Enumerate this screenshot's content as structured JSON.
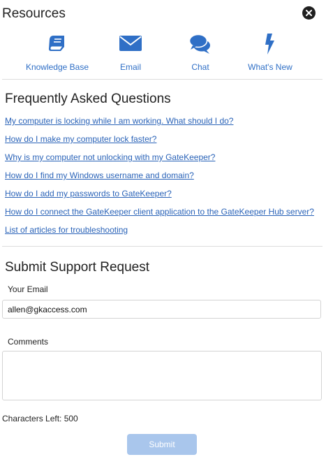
{
  "header": {
    "title": "Resources",
    "close_icon": "close-circle-icon"
  },
  "accent_color": "#2f6fc6",
  "quick_links": [
    {
      "label": "Knowledge Base",
      "icon": "book-icon"
    },
    {
      "label": "Email",
      "icon": "envelope-icon"
    },
    {
      "label": "Chat",
      "icon": "chat-bubbles-icon"
    },
    {
      "label": "What's New",
      "icon": "lightning-icon"
    }
  ],
  "faq": {
    "title": "Frequently Asked Questions",
    "links": [
      "My computer is locking while I am working. What should I do?",
      "How do I make my computer lock faster?",
      "Why is my computer not unlocking with my GateKeeper?",
      "How do I find my Windows username and domain?",
      "How do I add my passwords to GateKeeper?",
      "How do I connect the GateKeeper client application to the GateKeeper Hub server?",
      "List of articles for troubleshooting"
    ]
  },
  "support": {
    "title": "Submit Support Request",
    "email_label": "Your Email",
    "email_value": "allen@gkaccess.com",
    "comments_label": "Comments",
    "comments_value": "",
    "chars_left": "Characters Left: 500",
    "submit_label": "Submit"
  }
}
